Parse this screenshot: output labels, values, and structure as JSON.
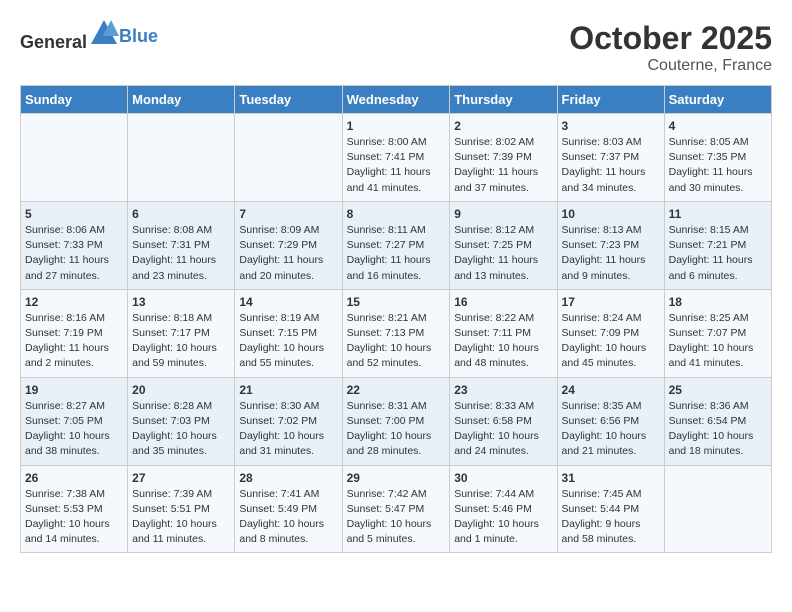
{
  "header": {
    "logo_general": "General",
    "logo_blue": "Blue",
    "month": "October 2025",
    "location": "Couterne, France"
  },
  "days_of_week": [
    "Sunday",
    "Monday",
    "Tuesday",
    "Wednesday",
    "Thursday",
    "Friday",
    "Saturday"
  ],
  "weeks": [
    [
      {
        "day": "",
        "info": ""
      },
      {
        "day": "",
        "info": ""
      },
      {
        "day": "",
        "info": ""
      },
      {
        "day": "1",
        "info": "Sunrise: 8:00 AM\nSunset: 7:41 PM\nDaylight: 11 hours\nand 41 minutes."
      },
      {
        "day": "2",
        "info": "Sunrise: 8:02 AM\nSunset: 7:39 PM\nDaylight: 11 hours\nand 37 minutes."
      },
      {
        "day": "3",
        "info": "Sunrise: 8:03 AM\nSunset: 7:37 PM\nDaylight: 11 hours\nand 34 minutes."
      },
      {
        "day": "4",
        "info": "Sunrise: 8:05 AM\nSunset: 7:35 PM\nDaylight: 11 hours\nand 30 minutes."
      }
    ],
    [
      {
        "day": "5",
        "info": "Sunrise: 8:06 AM\nSunset: 7:33 PM\nDaylight: 11 hours\nand 27 minutes."
      },
      {
        "day": "6",
        "info": "Sunrise: 8:08 AM\nSunset: 7:31 PM\nDaylight: 11 hours\nand 23 minutes."
      },
      {
        "day": "7",
        "info": "Sunrise: 8:09 AM\nSunset: 7:29 PM\nDaylight: 11 hours\nand 20 minutes."
      },
      {
        "day": "8",
        "info": "Sunrise: 8:11 AM\nSunset: 7:27 PM\nDaylight: 11 hours\nand 16 minutes."
      },
      {
        "day": "9",
        "info": "Sunrise: 8:12 AM\nSunset: 7:25 PM\nDaylight: 11 hours\nand 13 minutes."
      },
      {
        "day": "10",
        "info": "Sunrise: 8:13 AM\nSunset: 7:23 PM\nDaylight: 11 hours\nand 9 minutes."
      },
      {
        "day": "11",
        "info": "Sunrise: 8:15 AM\nSunset: 7:21 PM\nDaylight: 11 hours\nand 6 minutes."
      }
    ],
    [
      {
        "day": "12",
        "info": "Sunrise: 8:16 AM\nSunset: 7:19 PM\nDaylight: 11 hours\nand 2 minutes."
      },
      {
        "day": "13",
        "info": "Sunrise: 8:18 AM\nSunset: 7:17 PM\nDaylight: 10 hours\nand 59 minutes."
      },
      {
        "day": "14",
        "info": "Sunrise: 8:19 AM\nSunset: 7:15 PM\nDaylight: 10 hours\nand 55 minutes."
      },
      {
        "day": "15",
        "info": "Sunrise: 8:21 AM\nSunset: 7:13 PM\nDaylight: 10 hours\nand 52 minutes."
      },
      {
        "day": "16",
        "info": "Sunrise: 8:22 AM\nSunset: 7:11 PM\nDaylight: 10 hours\nand 48 minutes."
      },
      {
        "day": "17",
        "info": "Sunrise: 8:24 AM\nSunset: 7:09 PM\nDaylight: 10 hours\nand 45 minutes."
      },
      {
        "day": "18",
        "info": "Sunrise: 8:25 AM\nSunset: 7:07 PM\nDaylight: 10 hours\nand 41 minutes."
      }
    ],
    [
      {
        "day": "19",
        "info": "Sunrise: 8:27 AM\nSunset: 7:05 PM\nDaylight: 10 hours\nand 38 minutes."
      },
      {
        "day": "20",
        "info": "Sunrise: 8:28 AM\nSunset: 7:03 PM\nDaylight: 10 hours\nand 35 minutes."
      },
      {
        "day": "21",
        "info": "Sunrise: 8:30 AM\nSunset: 7:02 PM\nDaylight: 10 hours\nand 31 minutes."
      },
      {
        "day": "22",
        "info": "Sunrise: 8:31 AM\nSunset: 7:00 PM\nDaylight: 10 hours\nand 28 minutes."
      },
      {
        "day": "23",
        "info": "Sunrise: 8:33 AM\nSunset: 6:58 PM\nDaylight: 10 hours\nand 24 minutes."
      },
      {
        "day": "24",
        "info": "Sunrise: 8:35 AM\nSunset: 6:56 PM\nDaylight: 10 hours\nand 21 minutes."
      },
      {
        "day": "25",
        "info": "Sunrise: 8:36 AM\nSunset: 6:54 PM\nDaylight: 10 hours\nand 18 minutes."
      }
    ],
    [
      {
        "day": "26",
        "info": "Sunrise: 7:38 AM\nSunset: 5:53 PM\nDaylight: 10 hours\nand 14 minutes."
      },
      {
        "day": "27",
        "info": "Sunrise: 7:39 AM\nSunset: 5:51 PM\nDaylight: 10 hours\nand 11 minutes."
      },
      {
        "day": "28",
        "info": "Sunrise: 7:41 AM\nSunset: 5:49 PM\nDaylight: 10 hours\nand 8 minutes."
      },
      {
        "day": "29",
        "info": "Sunrise: 7:42 AM\nSunset: 5:47 PM\nDaylight: 10 hours\nand 5 minutes."
      },
      {
        "day": "30",
        "info": "Sunrise: 7:44 AM\nSunset: 5:46 PM\nDaylight: 10 hours\nand 1 minute."
      },
      {
        "day": "31",
        "info": "Sunrise: 7:45 AM\nSunset: 5:44 PM\nDaylight: 9 hours\nand 58 minutes."
      },
      {
        "day": "",
        "info": ""
      }
    ]
  ]
}
